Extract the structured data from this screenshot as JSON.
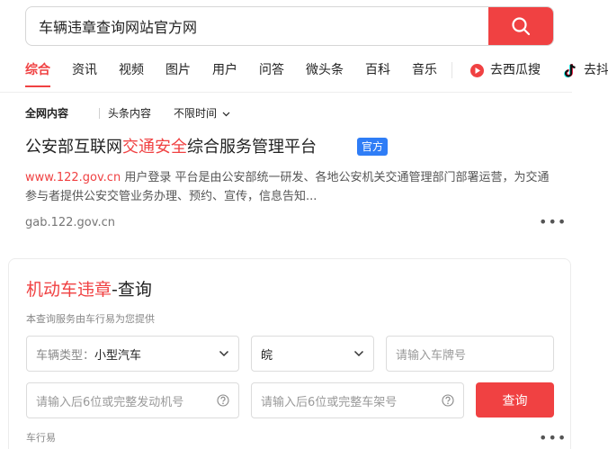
{
  "search": {
    "query": "车辆违章查询网站官方网"
  },
  "tabs": [
    {
      "label": "综合",
      "active": true
    },
    {
      "label": "资讯"
    },
    {
      "label": "视频"
    },
    {
      "label": "图片"
    },
    {
      "label": "用户"
    },
    {
      "label": "问答"
    },
    {
      "label": "微头条"
    },
    {
      "label": "百科"
    },
    {
      "label": "音乐"
    }
  ],
  "external_tabs": [
    {
      "label": "去西瓜搜",
      "icon": "xigua-icon"
    },
    {
      "label": "去抖",
      "icon": "douyin-icon"
    }
  ],
  "filters": {
    "scope_all": "全网内容",
    "scope_toutiao": "头条内容",
    "time": "不限时间"
  },
  "result1": {
    "title_prefix": "公安部互联网",
    "title_highlight": "交通安全",
    "title_suffix": "综合服务管理平台",
    "badge": "官方",
    "desc_url": "www.122.gov.cn",
    "desc_text": " 用户登录 平台是由公安部统一研发、各地公安机关交通管理部门部署运营，为交通参与者提供公安交管业务办理、预约、宣传，信息告知...",
    "site": "gab.122.gov.cn"
  },
  "card": {
    "title_red": "机动车违章",
    "title_rest": "-查询",
    "subtitle": "本查询服务由车行易为您提供",
    "vehicle_type_label": "车辆类型：",
    "vehicle_type_value": "小型汽车",
    "province_value": "皖",
    "plate_placeholder": "请输入车牌号",
    "engine_placeholder": "请输入后6位或完整发动机号",
    "frame_placeholder": "请输入后6位或完整车架号",
    "query_label": "查询",
    "footer": "车行易"
  },
  "colors": {
    "accent": "#f04142",
    "badge": "#2f7df6"
  }
}
